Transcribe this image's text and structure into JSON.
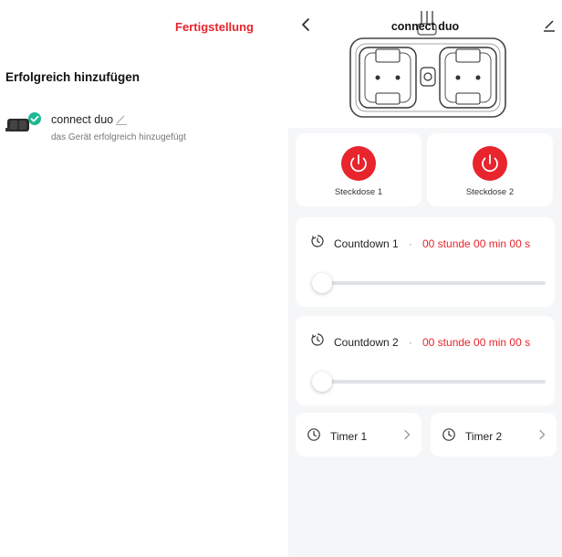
{
  "left_panel": {
    "done_label": "Fertigstellung",
    "title": "Erfolgreich hinzufügen",
    "device": {
      "name": "connect duo",
      "status": "das Gerät erfolgreich hinzugefügt"
    }
  },
  "right_panel": {
    "header": {
      "title": "connect duo"
    },
    "sockets": [
      {
        "label": "Steckdose 1",
        "color": "#e8242c"
      },
      {
        "label": "Steckdose 2",
        "color": "#e8242c"
      }
    ],
    "countdowns": [
      {
        "label": "Countdown 1",
        "separator": "·",
        "time": "00 stunde 00 min 00 s",
        "level": 0
      },
      {
        "label": "Countdown 2",
        "separator": "·",
        "time": "00 stunde 00 min 00 s",
        "level": 0
      }
    ],
    "timers": [
      {
        "label": "Timer 1"
      },
      {
        "label": "Timer 2"
      }
    ]
  },
  "colors": {
    "accent": "#e8242c",
    "success_badge": "#1fb894",
    "background_right": "#f5f6f8"
  }
}
